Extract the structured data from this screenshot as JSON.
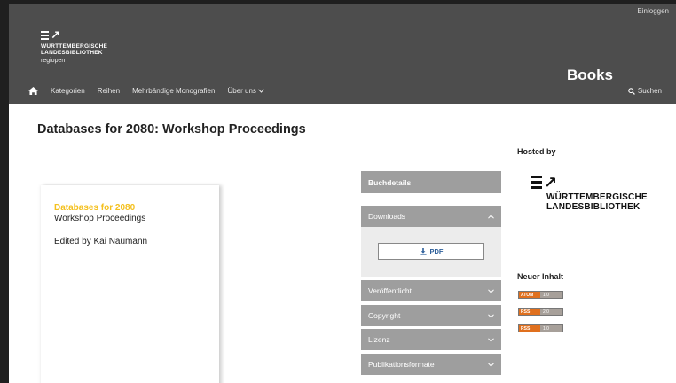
{
  "header": {
    "login": "Einloggen",
    "logo_name_line1": "WÜRTTEMBERGISCHE",
    "logo_name_line2": "LANDESBIBLIOTHEK",
    "logo_sub": "regiopen",
    "site_title": "Books",
    "nav": [
      "Kategorien",
      "Reihen",
      "Mehrbändige Monografien",
      "Über uns"
    ],
    "search_label": "Suchen"
  },
  "book": {
    "title": "Databases for 2080: Workshop Proceedings",
    "cover_title": "Databases for 2080",
    "cover_subtitle": "Workshop Proceedings",
    "cover_editor": "Edited by Kai Naumann"
  },
  "accordion": {
    "details": "Buchdetails",
    "downloads": "Downloads",
    "pdf": "PDF",
    "published": "Veröffentlicht",
    "copyright": "Copyright",
    "license": "Lizenz",
    "formats": "Publikationsformate"
  },
  "sidebar": {
    "hosted_by": "Hosted by",
    "host_line1": "WÜRTTEMBERGISCHE",
    "host_line2": "LANDESBIBLIOTHEK",
    "new_content": "Neuer Inhalt",
    "feeds": [
      {
        "label": "ATOM",
        "version": "1.0",
        "color": "#e0701e"
      },
      {
        "label": "RSS",
        "version": "2.0",
        "color": "#e0701e"
      },
      {
        "label": "RSS",
        "version": "1.0",
        "color": "#e0701e"
      }
    ]
  },
  "colors": {
    "header_bg": "#4d4d4d",
    "accordion_bg": "#9e9e9e",
    "cover_accent": "#f4c01e",
    "link": "#2d5f9a"
  }
}
